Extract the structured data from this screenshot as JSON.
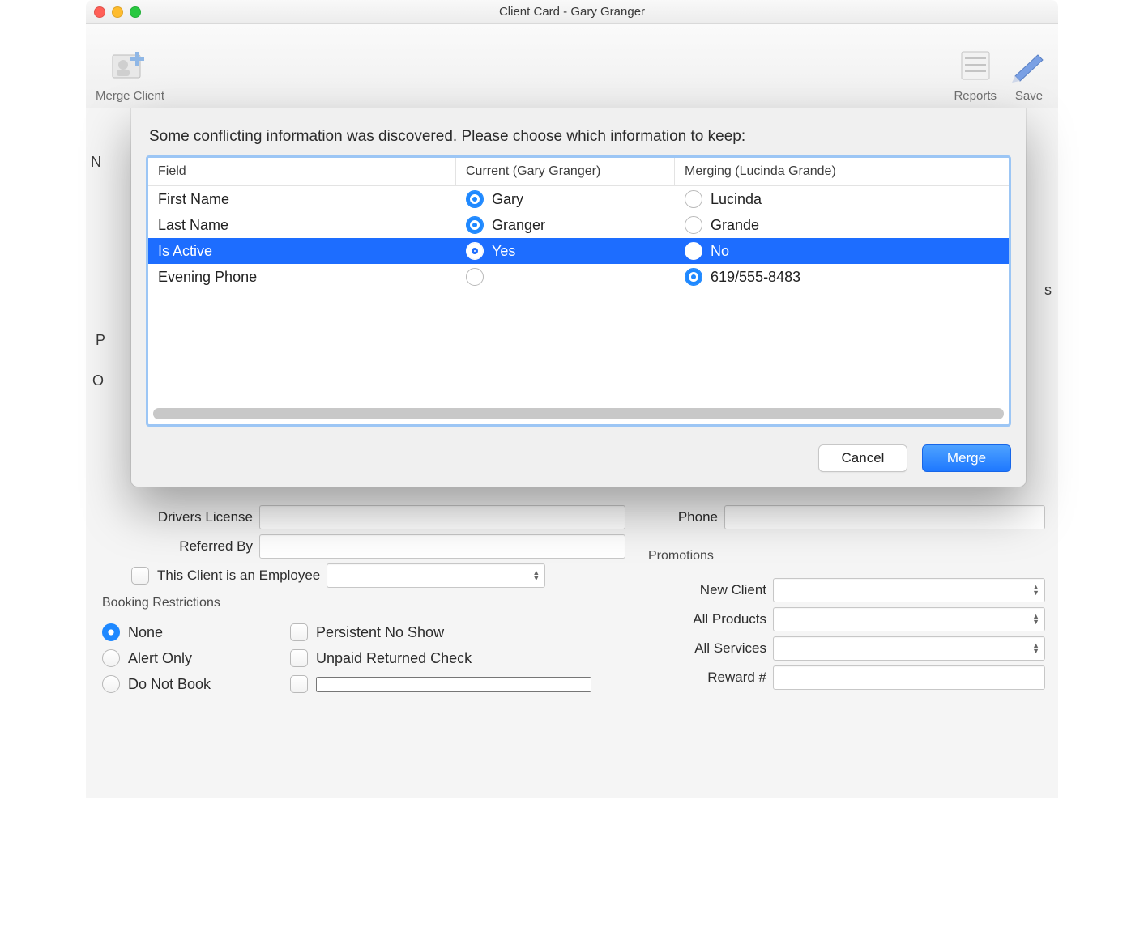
{
  "window": {
    "title": "Client Card - Gary Granger"
  },
  "toolbar": {
    "merge_client": "Merge Client",
    "reports": "Reports",
    "save": "Save"
  },
  "bg_form": {
    "name_section": "N",
    "p_section": "P",
    "o_section": "O",
    "drivers_license": "Drivers License",
    "referred_by": "Referred By",
    "employee_checkbox": "This Client is an Employee",
    "phone_label": "Phone",
    "promotions_section": "Promotions",
    "new_client": "New Client",
    "all_products": "All Products",
    "all_services": "All Services",
    "reward_num": "Reward #",
    "booking_restrictions": "Booking Restrictions",
    "restrict": {
      "none": "None",
      "persistent_no_show": "Persistent No Show",
      "alert_only": "Alert Only",
      "unpaid_returned_check": "Unpaid Returned Check",
      "do_not_book": "Do Not Book"
    },
    "right_peek": "s"
  },
  "dialog": {
    "message": "Some conflicting information was discovered. Please choose which information to keep:",
    "headers": {
      "field": "Field",
      "current": "Current (Gary Granger)",
      "merging": "Merging (Lucinda Grande)"
    },
    "rows": [
      {
        "field": "First Name",
        "current": "Gary",
        "merging": "Lucinda",
        "selected": "current",
        "highlight": false
      },
      {
        "field": "Last Name",
        "current": "Granger",
        "merging": "Grande",
        "selected": "current",
        "highlight": false
      },
      {
        "field": "Is Active",
        "current": "Yes",
        "merging": "No",
        "selected": "current",
        "highlight": true
      },
      {
        "field": "Evening Phone",
        "current": "",
        "merging": "619/555-8483",
        "selected": "merging",
        "highlight": false
      }
    ],
    "buttons": {
      "cancel": "Cancel",
      "merge": "Merge"
    }
  }
}
